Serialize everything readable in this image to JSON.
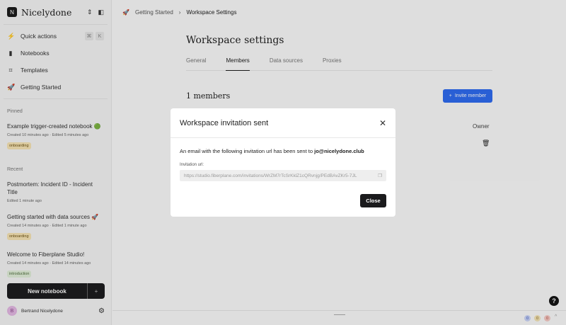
{
  "workspace": {
    "initial": "N",
    "name": "Nicelydone"
  },
  "nav": [
    {
      "label": "Quick actions",
      "icon": "⚡"
    },
    {
      "label": "Notebooks",
      "icon": "▮"
    },
    {
      "label": "Templates",
      "icon": "⌗"
    },
    {
      "label": "Getting Started",
      "icon": "🚀"
    }
  ],
  "shortcut": {
    "k1": "⌘",
    "k2": "K"
  },
  "pinned": {
    "title": "Pinned",
    "items": [
      {
        "title": "Example trigger-created notebook 🟢",
        "meta": "Created 10 minutes ago · Edited 5 minutes ago",
        "tag": "onboarding"
      }
    ]
  },
  "recent": {
    "title": "Recent",
    "items": [
      {
        "title": "Postmortem: Incident ID - Incident Title",
        "meta": "Edited 1 minute ago"
      },
      {
        "title": "Getting started with data sources 🚀",
        "meta": "Created 14 minutes ago · Edited 1 minute ago",
        "tag": "onboarding"
      },
      {
        "title": "Welcome to Fiberplane Studio!",
        "meta": "Created 14 minutes ago · Edited 14 minutes ago",
        "tag": "introduction"
      }
    ]
  },
  "new_notebook": "New notebook",
  "user": {
    "initial": "B",
    "name": "Bertrand Nicelydone"
  },
  "breadcrumb": [
    "Getting Started",
    "Workspace Settings"
  ],
  "page_title": "Workspace settings",
  "tabs": [
    "General",
    "Members",
    "Data sources",
    "Proxies"
  ],
  "members_count": "1 members",
  "invite_button": "Invite member",
  "owner_label": "Owner",
  "counters": [
    "0",
    "0",
    "0"
  ],
  "modal": {
    "title": "Workspace invitation sent",
    "text": "An email with the following invitation url has been sent to ",
    "email": "jo@nicelydone.club",
    "url_label": "Invitation url:",
    "url": "https://studio.fiberplane.com/invitations/WrZM7rTcSrKklZ1cQRvnjg/PEdBAvZKr5-7JL",
    "close": "Close"
  }
}
